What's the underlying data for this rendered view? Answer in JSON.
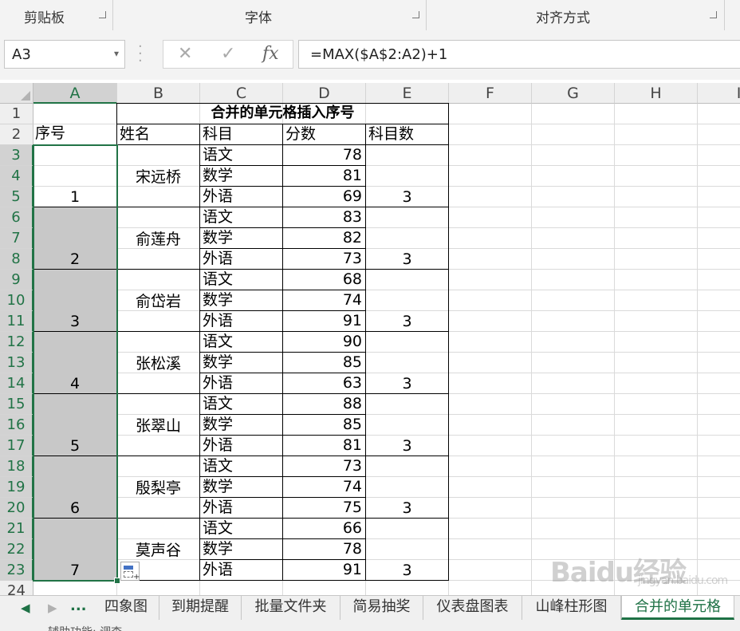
{
  "ribbon": {
    "groups": [
      {
        "label": "剪贴板"
      },
      {
        "label": "字体"
      },
      {
        "label": "对齐方式"
      }
    ]
  },
  "formula_bar": {
    "name_box": "A3",
    "cancel_icon": "✕",
    "enter_icon": "✓",
    "fx_label": "fx",
    "formula": "=MAX($A$2:A2)+1"
  },
  "columns": [
    "A",
    "B",
    "C",
    "D",
    "E",
    "F",
    "G",
    "H",
    "I"
  ],
  "rows": [
    "1",
    "2",
    "3",
    "4",
    "5",
    "6",
    "7",
    "8",
    "9",
    "10",
    "11",
    "12",
    "13",
    "14",
    "15",
    "16",
    "17",
    "18",
    "19",
    "20",
    "21",
    "22",
    "23",
    "24"
  ],
  "table": {
    "title": "合并的单元格插入序号",
    "headers": {
      "seq": "序号",
      "name": "姓名",
      "subject": "科目",
      "score": "分数",
      "count": "科目数"
    },
    "groups": [
      {
        "seq": "1",
        "name": "宋远桥",
        "count": "3",
        "rows": [
          {
            "subject": "语文",
            "score": "78"
          },
          {
            "subject": "数学",
            "score": "81"
          },
          {
            "subject": "外语",
            "score": "69"
          }
        ]
      },
      {
        "seq": "2",
        "name": "俞莲舟",
        "count": "3",
        "rows": [
          {
            "subject": "语文",
            "score": "83"
          },
          {
            "subject": "数学",
            "score": "82"
          },
          {
            "subject": "外语",
            "score": "73"
          }
        ]
      },
      {
        "seq": "3",
        "name": "俞岱岩",
        "count": "3",
        "rows": [
          {
            "subject": "语文",
            "score": "68"
          },
          {
            "subject": "数学",
            "score": "74"
          },
          {
            "subject": "外语",
            "score": "91"
          }
        ]
      },
      {
        "seq": "4",
        "name": "张松溪",
        "count": "3",
        "rows": [
          {
            "subject": "语文",
            "score": "90"
          },
          {
            "subject": "数学",
            "score": "85"
          },
          {
            "subject": "外语",
            "score": "63"
          }
        ]
      },
      {
        "seq": "5",
        "name": "张翠山",
        "count": "3",
        "rows": [
          {
            "subject": "语文",
            "score": "88"
          },
          {
            "subject": "数学",
            "score": "85"
          },
          {
            "subject": "外语",
            "score": "81"
          }
        ]
      },
      {
        "seq": "6",
        "name": "殷梨亭",
        "count": "3",
        "rows": [
          {
            "subject": "语文",
            "score": "73"
          },
          {
            "subject": "数学",
            "score": "74"
          },
          {
            "subject": "外语",
            "score": "75"
          }
        ]
      },
      {
        "seq": "7",
        "name": "莫声谷",
        "count": "3",
        "rows": [
          {
            "subject": "语文",
            "score": "66"
          },
          {
            "subject": "数学",
            "score": "78"
          },
          {
            "subject": "外语",
            "score": "91"
          }
        ]
      }
    ]
  },
  "sheet_tabs": {
    "more": "...",
    "tabs": [
      "四象图",
      "到期提醒",
      "批量文件夹",
      "简易抽奖",
      "仪表盘图表",
      "山峰柱形图",
      "合并的单元格"
    ],
    "active": "合并的单元格"
  },
  "status_bar": {
    "text": "辅助功能: 调查"
  },
  "watermark": {
    "text": "Baidu经验",
    "sub": "jingyan.baidu.com"
  },
  "colors": {
    "accent": "#217346",
    "selection_fill": "#c8c8c8"
  }
}
